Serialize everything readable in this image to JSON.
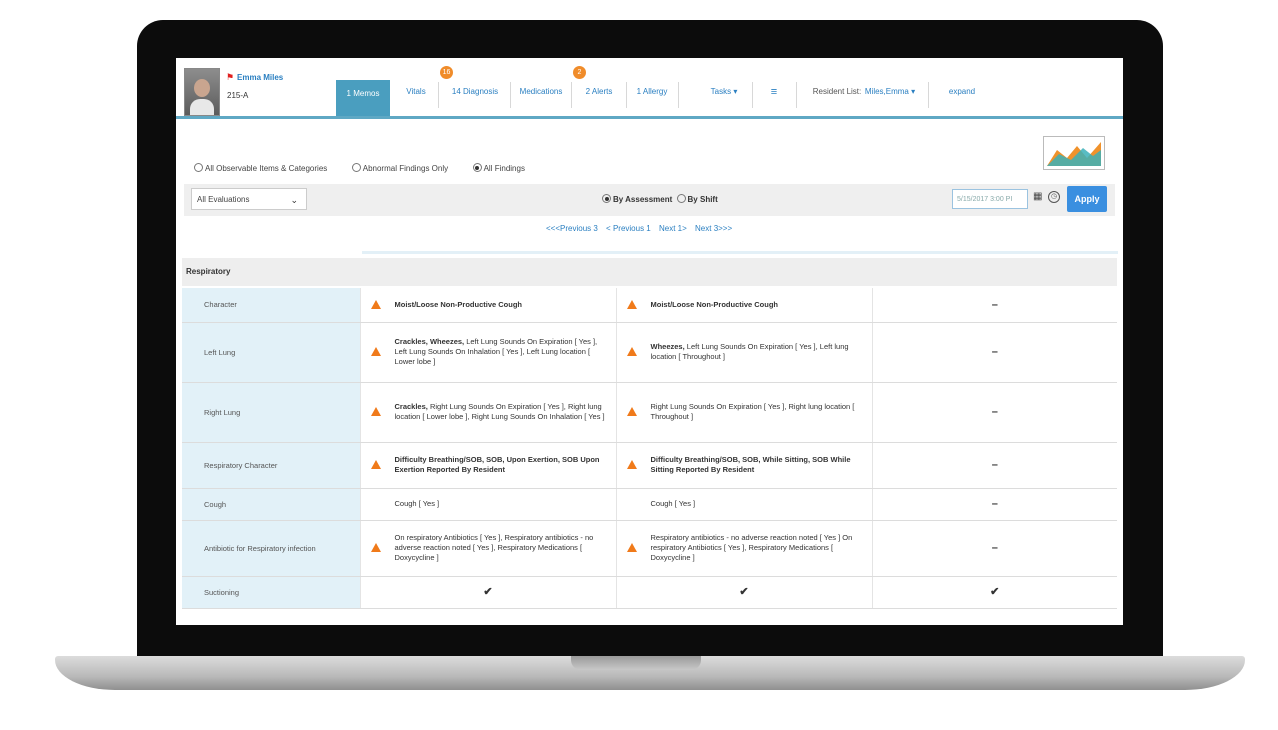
{
  "header": {
    "patient_name": "Emma Miles",
    "patient_room": "215-A",
    "tabs": [
      {
        "label": "1 Memos",
        "active": true
      },
      {
        "label": "Vitals",
        "active": false
      },
      {
        "label": "14 Diagnosis",
        "active": false
      },
      {
        "label": "Medications",
        "active": false
      },
      {
        "label": "2 Alerts",
        "active": false
      },
      {
        "label": "1 Allergy",
        "active": false
      },
      {
        "label": "Tasks ▾",
        "active": false
      },
      {
        "label": "≡",
        "active": false
      },
      {
        "label": "Resident List:",
        "active": false
      },
      {
        "label": "expand",
        "active": false
      }
    ],
    "diagnosis_badge": "16",
    "alerts_badge": "2",
    "resident_list_value": "Miles,Emma ▾"
  },
  "filters": {
    "options": [
      "All Observable Items & Categories",
      "Abnormal Findings Only",
      "All Findings"
    ],
    "selected": "All Findings"
  },
  "toolbar": {
    "evaluation_select": "All Evaluations",
    "view_options": [
      "By Assessment",
      "By Shift"
    ],
    "view_selected": "By Assessment",
    "date_value": "5/15/2017 3:00 PI",
    "apply_label": "Apply"
  },
  "pager": {
    "prev3": "<<<Previous 3",
    "prev1": "< Previous 1",
    "next1": "Next 1>",
    "next3": "Next 3>>>"
  },
  "section": {
    "title": "Respiratory"
  },
  "rows": [
    {
      "label": "Character",
      "c1_alert": true,
      "c1_bold": "Moist/Loose Non-Productive Cough",
      "c1_rest": "",
      "c2_alert": true,
      "c2_bold": "Moist/Loose Non-Productive Cough",
      "c2_rest": "",
      "c3": "–"
    },
    {
      "label": "Left Lung",
      "c1_alert": true,
      "c1_bold": "Crackles, Wheezes,",
      "c1_rest": " Left Lung Sounds On Expiration [ Yes ], Left Lung Sounds On Inhalation [ Yes ], Left Lung location [ Lower lobe ]",
      "c2_alert": true,
      "c2_bold": "Wheezes,",
      "c2_rest": " Left Lung Sounds On Expiration [ Yes ], Left lung location [ Throughout ]",
      "c3": "–"
    },
    {
      "label": "Right Lung",
      "c1_alert": true,
      "c1_bold": "Crackles,",
      "c1_rest": " Right Lung Sounds On Expiration [ Yes ], Right lung location [ Lower lobe ], Right Lung Sounds On Inhalation [ Yes ]",
      "c2_alert": true,
      "c2_bold": "",
      "c2_rest": "Right Lung Sounds On Expiration [ Yes ], Right lung location [ Throughout ]",
      "c3": "–"
    },
    {
      "label": "Respiratory Character",
      "c1_alert": true,
      "c1_bold": "Difficulty Breathing/SOB, SOB, Upon Exertion, SOB Upon Exertion Reported By Resident",
      "c1_rest": "",
      "c2_alert": true,
      "c2_bold": "Difficulty Breathing/SOB, SOB, While Sitting, SOB While Sitting Reported By Resident",
      "c2_rest": "",
      "c3": "–"
    },
    {
      "label": "Cough",
      "c1_alert": false,
      "c1_bold": "",
      "c1_rest": "Cough [ Yes ]",
      "c2_alert": false,
      "c2_bold": "",
      "c2_rest": "Cough [ Yes ]",
      "c3": "–"
    },
    {
      "label": "Antibiotic for Respiratory infection",
      "c1_alert": true,
      "c1_bold": "",
      "c1_rest": "On respiratory Antibiotics [ Yes ], Respiratory antibiotics - no adverse reaction noted [ Yes ], Respiratory Medications [ Doxycycline ]",
      "c2_alert": true,
      "c2_bold": "",
      "c2_rest": "Respiratory antibiotics - no adverse reaction noted [ Yes ] On respiratory Antibiotics [ Yes ], Respiratory Medications [ Doxycycline ]",
      "c3": "–"
    },
    {
      "label": "Suctioning",
      "c1_check": "✔",
      "c2_check": "✔",
      "c3": "✔"
    }
  ],
  "colors": {
    "accent": "#4a9ebf",
    "alert": "#f07a1a",
    "apply": "#3a8fe0",
    "label_bg": "#e2f1f8"
  }
}
